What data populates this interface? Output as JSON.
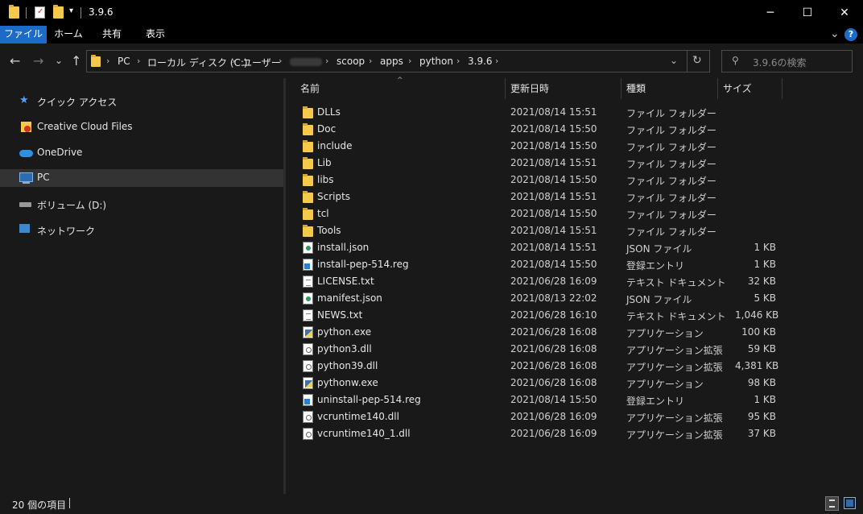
{
  "window": {
    "title": "3.9.6",
    "minimize_glyph": "─",
    "maximize_glyph": "☐",
    "close_glyph": "✕"
  },
  "ribbon": {
    "tabs": [
      "ファイル",
      "ホーム",
      "共有",
      "表示"
    ],
    "expand_glyph": "⌄",
    "help_glyph": "?"
  },
  "nav": {
    "back_glyph": "←",
    "forward_glyph": "→",
    "recent_glyph": "⌄",
    "up_glyph": "↑",
    "breadcrumb": [
      "PC",
      "ローカル ディスク (C:)",
      "ユーザー",
      "",
      "scoop",
      "apps",
      "python",
      "3.9.6"
    ],
    "refresh_glyph": "↻",
    "dropdown_glyph": "⌄",
    "search_placeholder": "3.9.6の検索"
  },
  "sidebar": {
    "items": [
      {
        "label": "クイック アクセス",
        "icon": "star-icon"
      },
      {
        "label": "Creative Cloud Files",
        "icon": "creative-cloud-folder-icon"
      },
      {
        "label": "OneDrive",
        "icon": "cloud-icon"
      },
      {
        "label": "PC",
        "icon": "monitor-icon"
      },
      {
        "label": "ボリューム (D:)",
        "icon": "drive-icon"
      },
      {
        "label": "ネットワーク",
        "icon": "network-icon"
      }
    ]
  },
  "columns": {
    "name": "名前",
    "date": "更新日時",
    "type": "種類",
    "size": "サイズ"
  },
  "files": [
    {
      "name": "DLLs",
      "date": "2021/08/14 15:51",
      "type": "ファイル フォルダー",
      "size": "",
      "icon": "folder"
    },
    {
      "name": "Doc",
      "date": "2021/08/14 15:50",
      "type": "ファイル フォルダー",
      "size": "",
      "icon": "folder"
    },
    {
      "name": "include",
      "date": "2021/08/14 15:50",
      "type": "ファイル フォルダー",
      "size": "",
      "icon": "folder"
    },
    {
      "name": "Lib",
      "date": "2021/08/14 15:51",
      "type": "ファイル フォルダー",
      "size": "",
      "icon": "folder"
    },
    {
      "name": "libs",
      "date": "2021/08/14 15:50",
      "type": "ファイル フォルダー",
      "size": "",
      "icon": "folder"
    },
    {
      "name": "Scripts",
      "date": "2021/08/14 15:51",
      "type": "ファイル フォルダー",
      "size": "",
      "icon": "folder"
    },
    {
      "name": "tcl",
      "date": "2021/08/14 15:50",
      "type": "ファイル フォルダー",
      "size": "",
      "icon": "folder"
    },
    {
      "name": "Tools",
      "date": "2021/08/14 15:51",
      "type": "ファイル フォルダー",
      "size": "",
      "icon": "folder"
    },
    {
      "name": "install.json",
      "date": "2021/08/14 15:51",
      "type": "JSON ファイル",
      "size": "1 KB",
      "icon": "json"
    },
    {
      "name": "install-pep-514.reg",
      "date": "2021/08/14 15:50",
      "type": "登録エントリ",
      "size": "1 KB",
      "icon": "reg"
    },
    {
      "name": "LICENSE.txt",
      "date": "2021/06/28 16:09",
      "type": "テキスト ドキュメント",
      "size": "32 KB",
      "icon": "doc"
    },
    {
      "name": "manifest.json",
      "date": "2021/08/13 22:02",
      "type": "JSON ファイル",
      "size": "5 KB",
      "icon": "json"
    },
    {
      "name": "NEWS.txt",
      "date": "2021/06/28 16:10",
      "type": "テキスト ドキュメント",
      "size": "1,046 KB",
      "icon": "doc"
    },
    {
      "name": "python.exe",
      "date": "2021/06/28 16:08",
      "type": "アプリケーション",
      "size": "100 KB",
      "icon": "exe"
    },
    {
      "name": "python3.dll",
      "date": "2021/06/28 16:08",
      "type": "アプリケーション拡張",
      "size": "59 KB",
      "icon": "dll"
    },
    {
      "name": "python39.dll",
      "date": "2021/06/28 16:08",
      "type": "アプリケーション拡張",
      "size": "4,381 KB",
      "icon": "dll"
    },
    {
      "name": "pythonw.exe",
      "date": "2021/06/28 16:08",
      "type": "アプリケーション",
      "size": "98 KB",
      "icon": "exe"
    },
    {
      "name": "uninstall-pep-514.reg",
      "date": "2021/08/14 15:50",
      "type": "登録エントリ",
      "size": "1 KB",
      "icon": "reg"
    },
    {
      "name": "vcruntime140.dll",
      "date": "2021/06/28 16:09",
      "type": "アプリケーション拡張",
      "size": "95 KB",
      "icon": "dll"
    },
    {
      "name": "vcruntime140_1.dll",
      "date": "2021/06/28 16:09",
      "type": "アプリケーション拡張",
      "size": "37 KB",
      "icon": "dll"
    }
  ],
  "status": {
    "text": "20 個の項目"
  },
  "colors": {
    "accent": "#1d6bc8",
    "folder": "#f5c94c",
    "background": "#191919",
    "titlebar": "#000000"
  }
}
